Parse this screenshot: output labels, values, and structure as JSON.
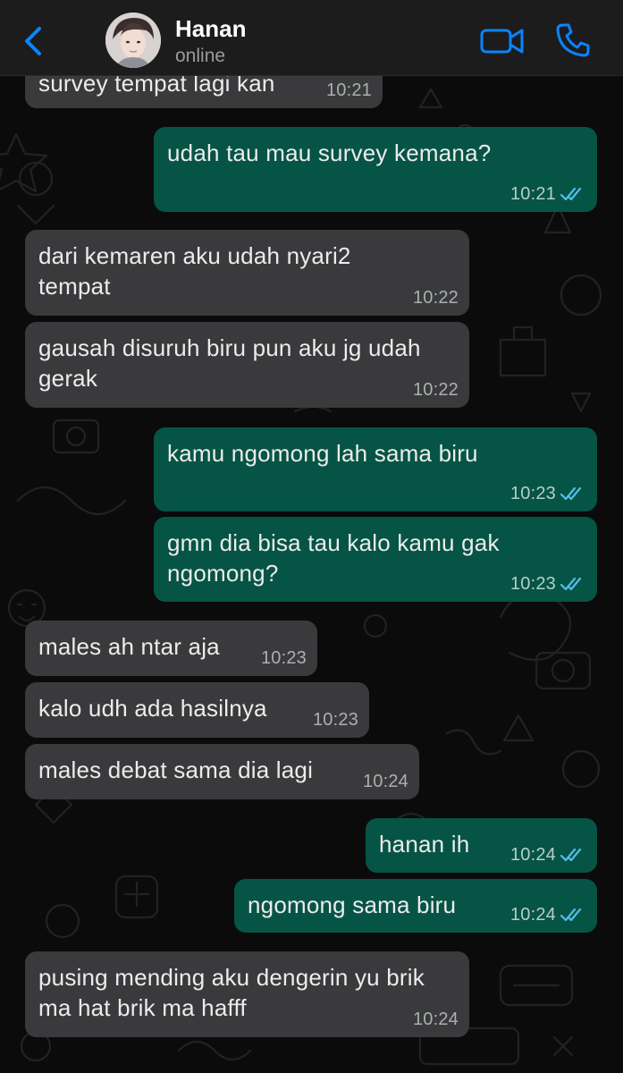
{
  "header": {
    "back_icon": "chevron-left-icon",
    "contact_name": "Hanan",
    "status": "online",
    "video_icon": "video-camera-icon",
    "phone_icon": "phone-icon"
  },
  "colors": {
    "accent": "#0a84ff",
    "incoming_bubble": "#3a3a3c",
    "outgoing_bubble": "#065445",
    "read_ticks": "#53bdeb",
    "header_bg": "#1c1c1d"
  },
  "messages": [
    {
      "direction": "in",
      "text": "survey tempat lagi kan",
      "time": "10:21",
      "status": ""
    },
    {
      "direction": "out",
      "text": "udah tau mau survey kemana?",
      "time": "10:21",
      "status": "read"
    },
    {
      "direction": "in",
      "text": "dari kemaren aku udah nyari2 tempat",
      "time": "10:22",
      "status": ""
    },
    {
      "direction": "in",
      "text": "gausah disuruh biru pun aku jg udah gerak",
      "time": "10:22",
      "status": ""
    },
    {
      "direction": "out",
      "text": "kamu ngomong lah sama biru",
      "time": "10:23",
      "status": "read"
    },
    {
      "direction": "out",
      "text": "gmn dia bisa tau kalo kamu gak ngomong?",
      "time": "10:23",
      "status": "read"
    },
    {
      "direction": "in",
      "text": "males ah ntar aja",
      "time": "10:23",
      "status": ""
    },
    {
      "direction": "in",
      "text": "kalo udh ada hasilnya",
      "time": "10:23",
      "status": ""
    },
    {
      "direction": "in",
      "text": "males debat sama dia lagi",
      "time": "10:24",
      "status": ""
    },
    {
      "direction": "out",
      "text": "hanan ih",
      "time": "10:24",
      "status": "read"
    },
    {
      "direction": "out",
      "text": "ngomong sama biru",
      "time": "10:24",
      "status": "read"
    },
    {
      "direction": "in",
      "text": "pusing mending aku dengerin yu brik ma hat brik ma hafff",
      "time": "10:24",
      "status": ""
    }
  ]
}
